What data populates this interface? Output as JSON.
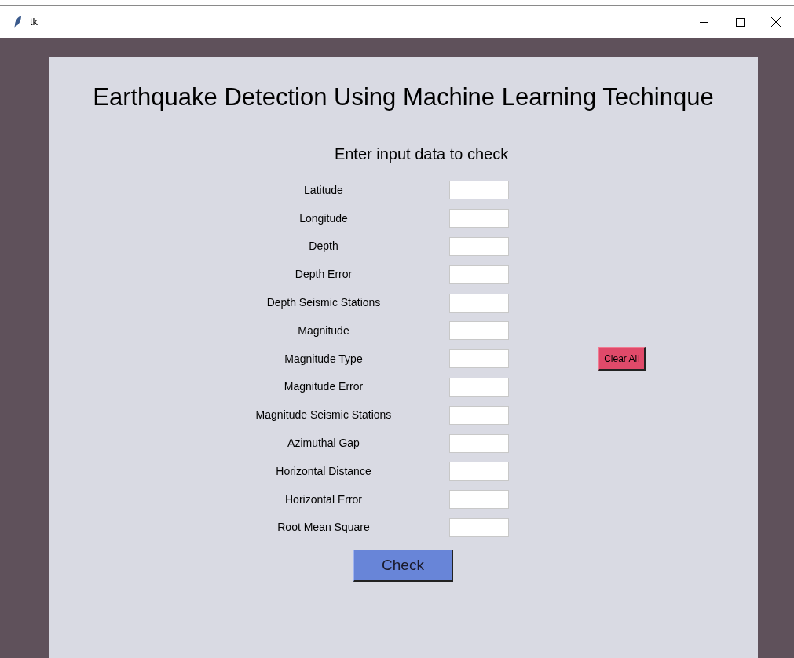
{
  "window": {
    "title": "tk"
  },
  "heading": "Earthquake Detection Using Machine Learning Techinque",
  "subheading": "Enter input data to check",
  "fields": [
    {
      "label": "Latitude"
    },
    {
      "label": "Longitude"
    },
    {
      "label": "Depth"
    },
    {
      "label": "Depth Error"
    },
    {
      "label": "Depth Seismic Stations"
    },
    {
      "label": "Magnitude"
    },
    {
      "label": "Magnitude Type"
    },
    {
      "label": "Magnitude Error"
    },
    {
      "label": "Magnitude Seismic Stations"
    },
    {
      "label": "Azimuthal Gap"
    },
    {
      "label": "Horizontal Distance"
    },
    {
      "label": "Horizontal Error"
    },
    {
      "label": "Root Mean Square"
    }
  ],
  "clear_button": "Clear All",
  "check_button": "Check"
}
